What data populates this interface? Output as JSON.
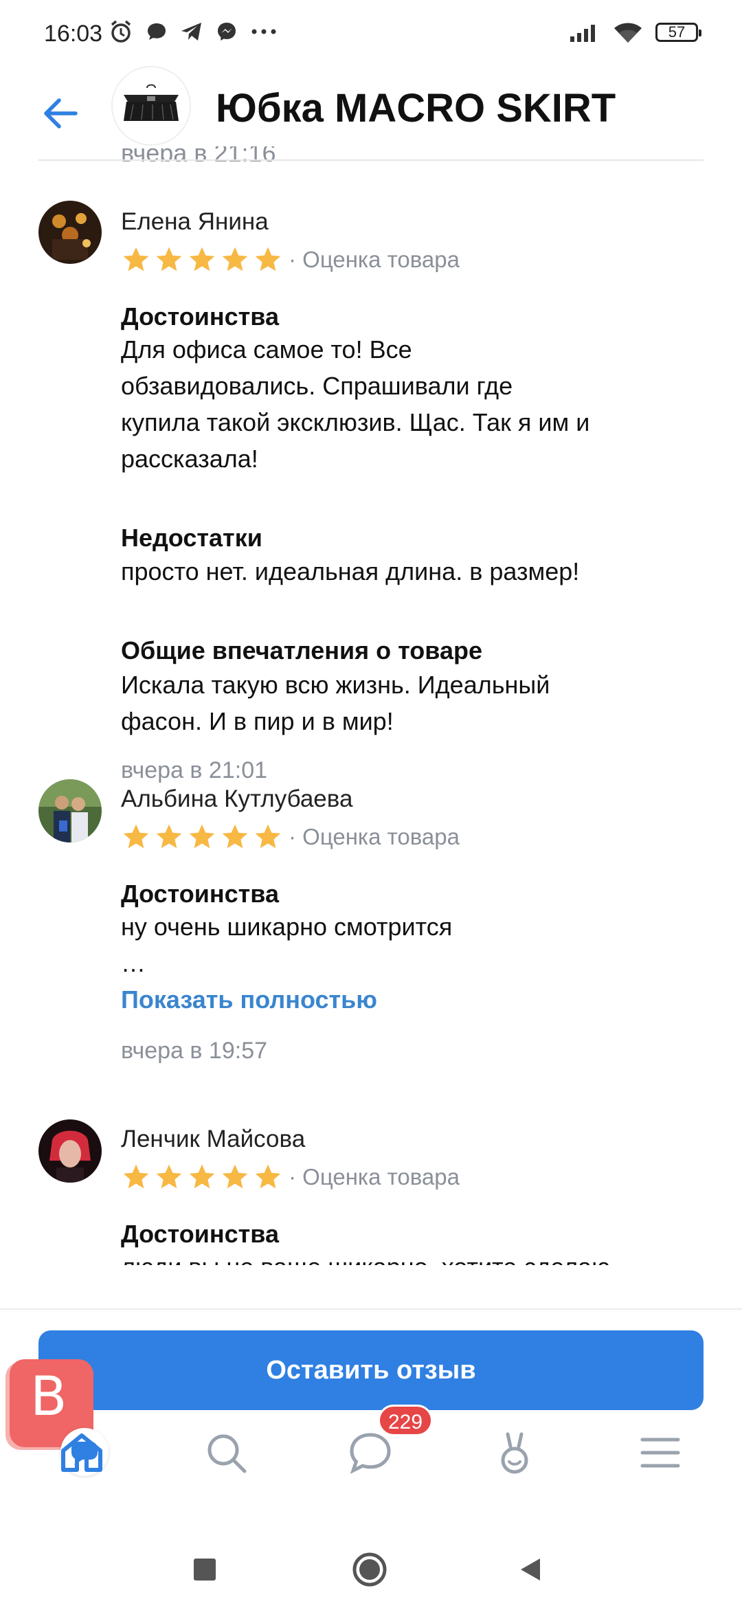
{
  "status_bar": {
    "time": "16:03",
    "battery": "57",
    "icons": [
      "alarm-icon",
      "chat-bubble-icon",
      "telegram-icon",
      "messenger-icon",
      "more-dots-icon",
      "signal-icon",
      "wifi-icon",
      "battery-icon"
    ]
  },
  "header": {
    "title": "Юбка MACRO SKIRT",
    "cut_timestamp": "вчера в 21:16"
  },
  "reviews": [
    {
      "name": "Елена Янина",
      "rating": 5,
      "rating_label": "· Оценка товара",
      "sections": [
        {
          "title": "Достоинства",
          "text": "Для офиса самое то!  Все\nобзавидовались. Спрашивали где\nкупила такой эксклюзив. Щас. Так я им и\nрассказала!"
        },
        {
          "title": "Недостатки",
          "text": "просто нет. идеальная длина. в размер!"
        },
        {
          "title": "Общие впечатления о товаре",
          "text": "Искала такую всю жизнь. Идеальный\nфасон. И в пир и в мир!"
        }
      ],
      "date": "вчера в 21:01"
    },
    {
      "name": "Альбина Кутлубаева",
      "rating": 5,
      "rating_label": "· Оценка товара",
      "sections": [
        {
          "title": "Достоинства",
          "text": "ну очень шикарно смотрится\n…"
        }
      ],
      "show_more": "Показать полностью",
      "date": "вчера в 19:57"
    },
    {
      "name": "Ленчик Майсова",
      "rating": 5,
      "rating_label": "· Оценка товара",
      "sections": [
        {
          "title": "Достоинства",
          "text": "люди вы не ваще шикарно, хотите сделаю"
        }
      ]
    }
  ],
  "actions": {
    "leave_review": "Оставить отзыв"
  },
  "bubble_app": {
    "letter": "B"
  },
  "tabbar": {
    "messages_badge": "229",
    "tabs": [
      "home-icon",
      "search-icon",
      "messages-icon",
      "services-icon",
      "menu-icon"
    ]
  },
  "colors": {
    "accent": "#2f80e2",
    "star": "#f7b844",
    "badge": "#e64646",
    "secondary_text": "#8a8f98"
  }
}
